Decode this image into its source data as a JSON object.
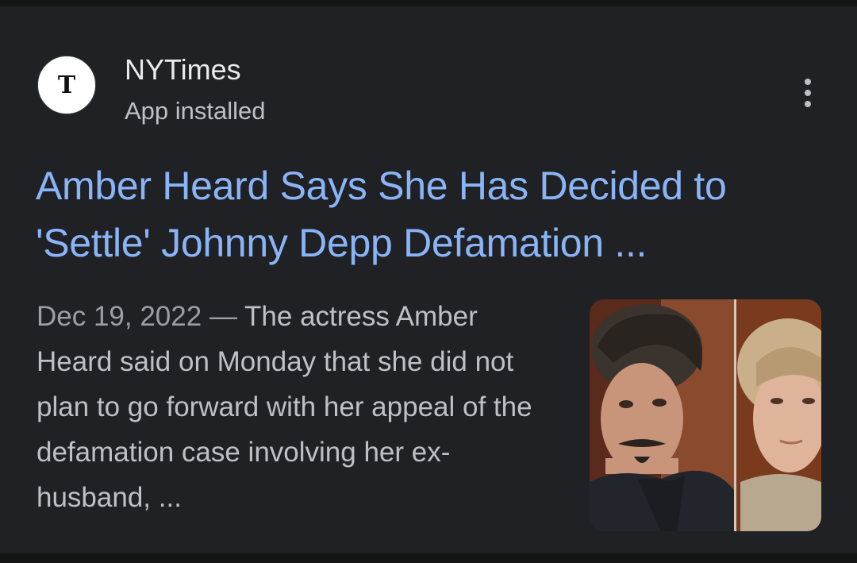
{
  "result": {
    "source": {
      "logo_glyph": "ᵗ",
      "logo_letter": "T",
      "name": "NYTimes",
      "subtitle": "App installed"
    },
    "menu_icon": "more-vert-icon",
    "title_line1": "Amber Heard Says She Has Decided to",
    "title_line2": "'Settle' Johnny Depp Defamation ...",
    "date": "Dec 19, 2022",
    "separator": " — ",
    "snippet": "The actress Amber Heard said on Monday that she did not plan to go forward with her appeal of the defamation case involving her ex-husband, ..."
  },
  "colors": {
    "background": "#202124",
    "title_link": "#8ab4f8",
    "primary_text": "#e8eaed",
    "secondary_text": "#bdc1c6"
  }
}
